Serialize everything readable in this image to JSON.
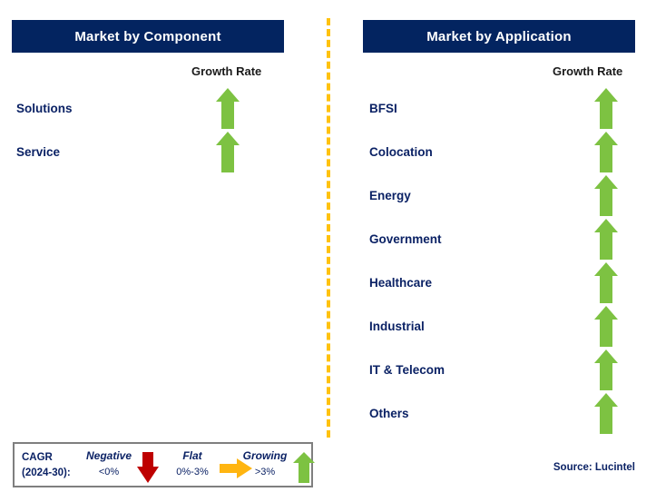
{
  "divider": {
    "color": "#FFC20E",
    "style": "dashed-vertical"
  },
  "theme": {
    "header_bg": "#032460",
    "label_navy": "#0b2265",
    "growth_green": "#7DC242",
    "negative_red": "#BE0000",
    "flat_orange": "#FFB511"
  },
  "panels": [
    {
      "id": "market-by-component",
      "title": "Market by Component",
      "growth_column_label": "Growth Rate",
      "rows": [
        {
          "label": "Solutions",
          "growth": "up",
          "growth_icon": "arrow-up-icon"
        },
        {
          "label": "Service",
          "growth": "up",
          "growth_icon": "arrow-up-icon"
        }
      ]
    },
    {
      "id": "market-by-application",
      "title": "Market by Application",
      "growth_column_label": "Growth Rate",
      "rows": [
        {
          "label": "BFSI",
          "growth": "up",
          "growth_icon": "arrow-up-icon"
        },
        {
          "label": "Colocation",
          "growth": "up",
          "growth_icon": "arrow-up-icon"
        },
        {
          "label": "Energy",
          "growth": "up",
          "growth_icon": "arrow-up-icon"
        },
        {
          "label": "Government",
          "growth": "up",
          "growth_icon": "arrow-up-icon"
        },
        {
          "label": "Healthcare",
          "growth": "up",
          "growth_icon": "arrow-up-icon"
        },
        {
          "label": "Industrial",
          "growth": "up",
          "growth_icon": "arrow-up-icon"
        },
        {
          "label": "IT & Telecom",
          "growth": "up",
          "growth_icon": "arrow-up-icon"
        },
        {
          "label": "Others",
          "growth": "up",
          "growth_icon": "arrow-up-icon"
        }
      ]
    }
  ],
  "legend": {
    "title_line1": "CAGR",
    "title_line2": "(2024-30):",
    "items": [
      {
        "term": "Negative",
        "range": "<0%",
        "icon": "arrow-down-icon",
        "color": "#BE0000"
      },
      {
        "term": "Flat",
        "range": "0%-3%",
        "icon": "arrow-right-icon",
        "color": "#FFB511"
      },
      {
        "term": "Growing",
        "range": ">3%",
        "icon": "arrow-up-icon",
        "color": "#7DC242"
      }
    ]
  },
  "source": "Source: Lucintel"
}
